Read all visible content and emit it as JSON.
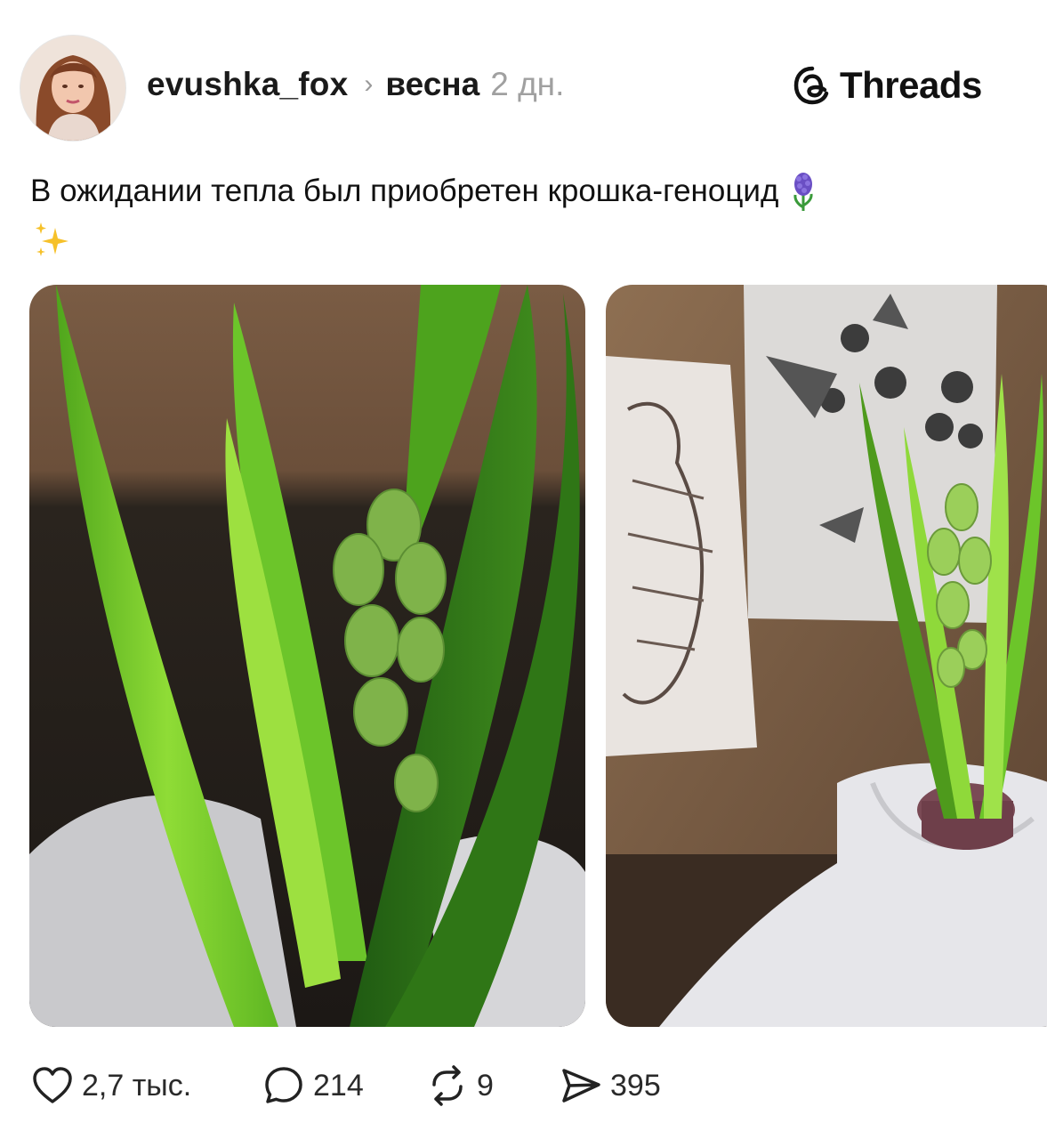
{
  "post": {
    "username": "evushka_fox",
    "separator": "›",
    "topic": "весна",
    "time": "2 дн.",
    "caption": "В ожидании тепла был приобретен крошка-геноцид",
    "caption_emojis": [
      "hyacinth-icon",
      "sparkles-icon"
    ]
  },
  "brand": {
    "name": "Threads",
    "icon": "threads-logo-icon"
  },
  "photos": [
    {
      "subject": "hyacinth close-up"
    },
    {
      "subject": "hyacinth in pot with tattoo sketches"
    }
  ],
  "actions": {
    "likes": "2,7 тыс.",
    "comments": "214",
    "reposts": "9",
    "shares": "395"
  },
  "colors": {
    "text": "#111111",
    "muted": "#a0a0a0",
    "leaf": "#7ccf2a"
  }
}
